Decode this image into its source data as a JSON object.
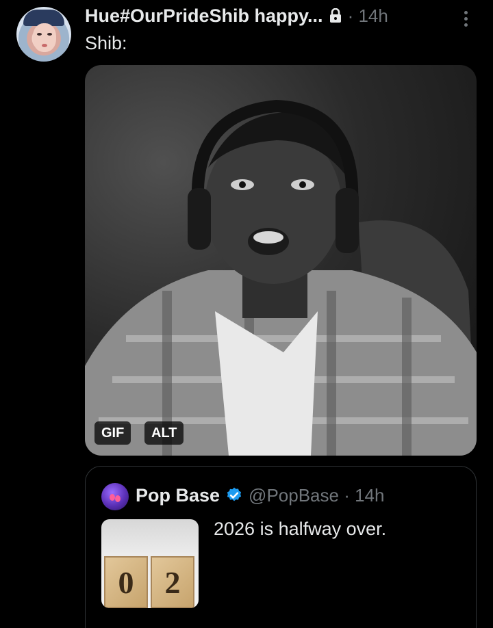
{
  "post": {
    "display_name": "Hue#OurPrideShib happy...",
    "time": "· 14h",
    "text": "Shib:",
    "icons": {
      "lock": "lock-icon",
      "more": "more-options-icon"
    },
    "media": {
      "badges": {
        "gif": "GIF",
        "alt": "ALT"
      }
    }
  },
  "quote": {
    "name": "Pop Base",
    "handle_time": "@PopBase · 14h",
    "text": "2026 is halfway over.",
    "thumbnail": {
      "digits": [
        "0",
        "2"
      ]
    },
    "icons": {
      "verified": "verified-badge-icon"
    }
  },
  "colors": {
    "background": "#000000",
    "text": "#e7e9ea",
    "muted": "#71767b",
    "border": "#2f3336",
    "verified": "#1d9bf0"
  }
}
